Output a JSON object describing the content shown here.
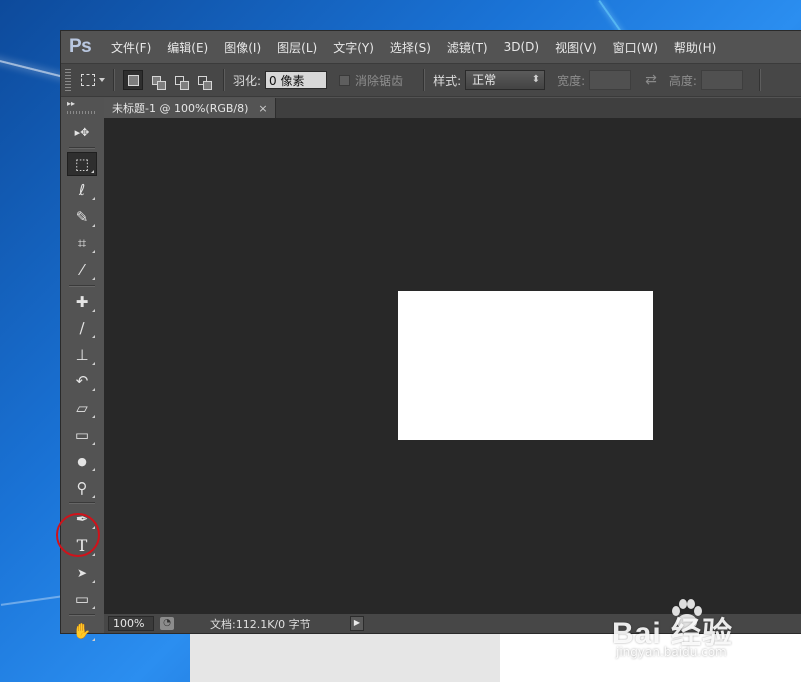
{
  "app": {
    "logo": "Ps"
  },
  "menubar": {
    "items": [
      "文件(F)",
      "编辑(E)",
      "图像(I)",
      "图层(L)",
      "文字(Y)",
      "选择(S)",
      "滤镜(T)",
      "3D(D)",
      "视图(V)",
      "窗口(W)",
      "帮助(H)"
    ]
  },
  "options": {
    "feather_label": "羽化:",
    "feather_value": "0 像素",
    "antialias_label": "消除锯齿",
    "style_label": "样式:",
    "style_value": "正常",
    "width_label": "宽度:",
    "height_label": "高度:"
  },
  "document": {
    "tab_title": "未标题-1 @ 100%(RGB/8)",
    "close_glyph": "×"
  },
  "status": {
    "zoom": "100%",
    "doc_info": "文档:112.1K/0 字节",
    "arrow": "▶"
  },
  "tools": [
    {
      "name": "move-tool",
      "glyph": "▸✥"
    },
    {
      "name": "rectangular-marquee-tool",
      "glyph": "⬚"
    },
    {
      "name": "lasso-tool",
      "glyph": "ℓ"
    },
    {
      "name": "quick-selection-tool",
      "glyph": "✎"
    },
    {
      "name": "crop-tool",
      "glyph": "⌗"
    },
    {
      "name": "eyedropper-tool",
      "glyph": "⁄"
    },
    {
      "name": "healing-brush-tool",
      "glyph": "✚"
    },
    {
      "name": "brush-tool",
      "glyph": "∕"
    },
    {
      "name": "clone-stamp-tool",
      "glyph": "⊥"
    },
    {
      "name": "history-brush-tool",
      "glyph": "↶"
    },
    {
      "name": "eraser-tool",
      "glyph": "▱"
    },
    {
      "name": "gradient-tool",
      "glyph": "▭"
    },
    {
      "name": "blur-tool",
      "glyph": "●"
    },
    {
      "name": "dodge-tool",
      "glyph": "⚲"
    },
    {
      "name": "pen-tool",
      "glyph": "✒"
    },
    {
      "name": "type-tool",
      "glyph": "T"
    },
    {
      "name": "path-selection-tool",
      "glyph": "➤"
    },
    {
      "name": "rectangle-tool",
      "glyph": "▭"
    },
    {
      "name": "hand-tool",
      "glyph": "✋"
    }
  ],
  "watermark": {
    "brand": "Bai 经验",
    "url": "jingyan.baidu.com"
  },
  "colors": {
    "highlight": "#d0121a",
    "canvas_bg": "#282828",
    "panel_bg": "#535353"
  }
}
